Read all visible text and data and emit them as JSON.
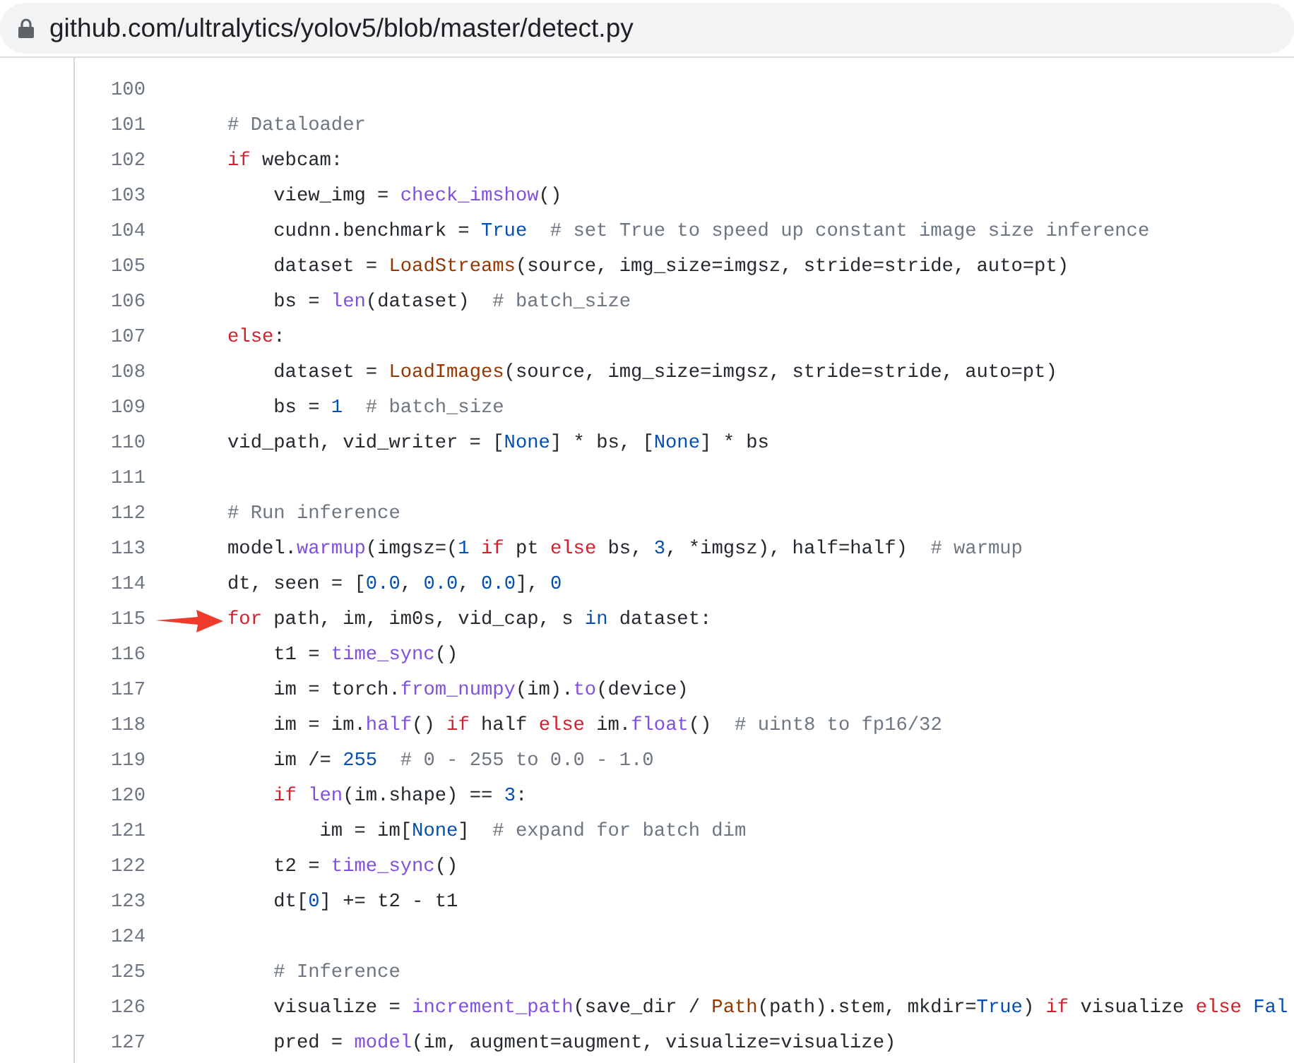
{
  "address_bar": {
    "url": "github.com/ultralytics/yolov5/blob/master/detect.py"
  },
  "code": {
    "lines": [
      {
        "number": "100",
        "marked": false
      },
      {
        "number": "101",
        "marked": false,
        "tokens": [
          {
            "kind": "comment",
            "text": "# Dataloader"
          }
        ]
      },
      {
        "number": "102",
        "marked": false,
        "tokens": [
          {
            "kind": "keyword",
            "text": "if"
          },
          {
            "kind": "plain",
            "text": " webcam:"
          }
        ]
      },
      {
        "number": "103",
        "marked": false,
        "tokens": [
          {
            "kind": "plain",
            "text": "    view_img = "
          },
          {
            "kind": "function",
            "text": "check_imshow"
          },
          {
            "kind": "plain",
            "text": "()"
          }
        ]
      },
      {
        "number": "104",
        "marked": false,
        "tokens": [
          {
            "kind": "plain",
            "text": "    cudnn.benchmark = "
          },
          {
            "kind": "constant",
            "text": "True"
          },
          {
            "kind": "comment",
            "text": "  # set True to speed up constant image size inference"
          }
        ]
      },
      {
        "number": "105",
        "marked": false,
        "tokens": [
          {
            "kind": "plain",
            "text": "    dataset = "
          },
          {
            "kind": "class",
            "text": "LoadStreams"
          },
          {
            "kind": "plain",
            "text": "(source, img_size=imgsz, stride=stride, auto=pt)"
          }
        ]
      },
      {
        "number": "106",
        "marked": false,
        "tokens": [
          {
            "kind": "plain",
            "text": "    bs = "
          },
          {
            "kind": "function",
            "text": "len"
          },
          {
            "kind": "plain",
            "text": "(dataset)  "
          },
          {
            "kind": "comment",
            "text": "# batch_size"
          }
        ]
      },
      {
        "number": "107",
        "marked": false,
        "tokens": [
          {
            "kind": "keyword",
            "text": "else"
          },
          {
            "kind": "plain",
            "text": ":"
          }
        ]
      },
      {
        "number": "108",
        "marked": false,
        "tokens": [
          {
            "kind": "plain",
            "text": "    dataset = "
          },
          {
            "kind": "class",
            "text": "LoadImages"
          },
          {
            "kind": "plain",
            "text": "(source, img_size=imgsz, stride=stride, auto=pt)"
          }
        ]
      },
      {
        "number": "109",
        "marked": false,
        "tokens": [
          {
            "kind": "plain",
            "text": "    bs = "
          },
          {
            "kind": "constant",
            "text": "1"
          },
          {
            "kind": "comment",
            "text": "  # batch_size"
          }
        ]
      },
      {
        "number": "110",
        "marked": false,
        "tokens": [
          {
            "kind": "plain",
            "text": "vid_path, vid_writer = ["
          },
          {
            "kind": "constant",
            "text": "None"
          },
          {
            "kind": "plain",
            "text": "] * bs, ["
          },
          {
            "kind": "constant",
            "text": "None"
          },
          {
            "kind": "plain",
            "text": "] * bs"
          }
        ]
      },
      {
        "number": "111",
        "marked": false
      },
      {
        "number": "112",
        "marked": false,
        "tokens": [
          {
            "kind": "comment",
            "text": "# Run inference"
          }
        ]
      },
      {
        "number": "113",
        "marked": false,
        "tokens": [
          {
            "kind": "plain",
            "text": "model."
          },
          {
            "kind": "function",
            "text": "warmup"
          },
          {
            "kind": "plain",
            "text": "(imgsz=("
          },
          {
            "kind": "constant",
            "text": "1"
          },
          {
            "kind": "keyword",
            "text": " if"
          },
          {
            "kind": "plain",
            "text": " pt "
          },
          {
            "kind": "keyword",
            "text": "else"
          },
          {
            "kind": "plain",
            "text": " bs, "
          },
          {
            "kind": "constant",
            "text": "3"
          },
          {
            "kind": "plain",
            "text": ", *imgsz), half=half)  "
          },
          {
            "kind": "comment",
            "text": "# warmup"
          }
        ]
      },
      {
        "number": "114",
        "marked": false,
        "tokens": [
          {
            "kind": "plain",
            "text": "dt, seen = ["
          },
          {
            "kind": "constant",
            "text": "0.0"
          },
          {
            "kind": "plain",
            "text": ", "
          },
          {
            "kind": "constant",
            "text": "0.0"
          },
          {
            "kind": "plain",
            "text": ", "
          },
          {
            "kind": "constant",
            "text": "0.0"
          },
          {
            "kind": "plain",
            "text": "], "
          },
          {
            "kind": "constant",
            "text": "0"
          }
        ]
      },
      {
        "number": "115",
        "marked": true,
        "tokens": [
          {
            "kind": "keyword",
            "text": "for"
          },
          {
            "kind": "plain",
            "text": " path, im, im0s, vid_cap, s "
          },
          {
            "kind": "constant",
            "text": "in"
          },
          {
            "kind": "plain",
            "text": " dataset:"
          }
        ]
      },
      {
        "number": "116",
        "marked": false,
        "tokens": [
          {
            "kind": "plain",
            "text": "    t1 = "
          },
          {
            "kind": "function",
            "text": "time_sync"
          },
          {
            "kind": "plain",
            "text": "()"
          }
        ]
      },
      {
        "number": "117",
        "marked": false,
        "tokens": [
          {
            "kind": "plain",
            "text": "    im = torch."
          },
          {
            "kind": "function",
            "text": "from_numpy"
          },
          {
            "kind": "plain",
            "text": "(im)."
          },
          {
            "kind": "function",
            "text": "to"
          },
          {
            "kind": "plain",
            "text": "(device)"
          }
        ]
      },
      {
        "number": "118",
        "marked": false,
        "tokens": [
          {
            "kind": "plain",
            "text": "    im = im."
          },
          {
            "kind": "function",
            "text": "half"
          },
          {
            "kind": "plain",
            "text": "() "
          },
          {
            "kind": "keyword",
            "text": "if"
          },
          {
            "kind": "plain",
            "text": " half "
          },
          {
            "kind": "keyword",
            "text": "else"
          },
          {
            "kind": "plain",
            "text": " im."
          },
          {
            "kind": "function",
            "text": "float"
          },
          {
            "kind": "plain",
            "text": "()  "
          },
          {
            "kind": "comment",
            "text": "# uint8 to fp16/32"
          }
        ]
      },
      {
        "number": "119",
        "marked": false,
        "tokens": [
          {
            "kind": "plain",
            "text": "    im /= "
          },
          {
            "kind": "constant",
            "text": "255"
          },
          {
            "kind": "comment",
            "text": "  # 0 - 255 to 0.0 - 1.0"
          }
        ]
      },
      {
        "number": "120",
        "marked": false,
        "tokens": [
          {
            "kind": "keyword",
            "text": "    if"
          },
          {
            "kind": "function",
            "text": " len"
          },
          {
            "kind": "plain",
            "text": "(im.shape) == "
          },
          {
            "kind": "constant",
            "text": "3"
          },
          {
            "kind": "plain",
            "text": ":"
          }
        ]
      },
      {
        "number": "121",
        "marked": false,
        "tokens": [
          {
            "kind": "plain",
            "text": "        im = im["
          },
          {
            "kind": "constant",
            "text": "None"
          },
          {
            "kind": "plain",
            "text": "]  "
          },
          {
            "kind": "comment",
            "text": "# expand for batch dim"
          }
        ]
      },
      {
        "number": "122",
        "marked": false,
        "tokens": [
          {
            "kind": "plain",
            "text": "    t2 = "
          },
          {
            "kind": "function",
            "text": "time_sync"
          },
          {
            "kind": "plain",
            "text": "()"
          }
        ]
      },
      {
        "number": "123",
        "marked": false,
        "tokens": [
          {
            "kind": "plain",
            "text": "    dt["
          },
          {
            "kind": "constant",
            "text": "0"
          },
          {
            "kind": "plain",
            "text": "] += t2 - t1"
          }
        ]
      },
      {
        "number": "124",
        "marked": false
      },
      {
        "number": "125",
        "marked": false,
        "tokens": [
          {
            "kind": "comment",
            "text": "    # Inference"
          }
        ]
      },
      {
        "number": "126",
        "marked": false,
        "tokens": [
          {
            "kind": "plain",
            "text": "    visualize = "
          },
          {
            "kind": "function",
            "text": "increment_path"
          },
          {
            "kind": "plain",
            "text": "(save_dir / "
          },
          {
            "kind": "class",
            "text": "Path"
          },
          {
            "kind": "plain",
            "text": "(path).stem, mkdir="
          },
          {
            "kind": "constant",
            "text": "True"
          },
          {
            "kind": "plain",
            "text": ") "
          },
          {
            "kind": "keyword",
            "text": "if"
          },
          {
            "kind": "plain",
            "text": " visualize "
          },
          {
            "kind": "keyword",
            "text": "else"
          },
          {
            "kind": "constant",
            "text": " Fal"
          }
        ]
      },
      {
        "number": "127",
        "marked": false,
        "tokens": [
          {
            "kind": "plain",
            "text": "    pred = "
          },
          {
            "kind": "function",
            "text": "model"
          },
          {
            "kind": "plain",
            "text": "(im, augment=augment, visualize=visualize)"
          }
        ]
      }
    ]
  }
}
